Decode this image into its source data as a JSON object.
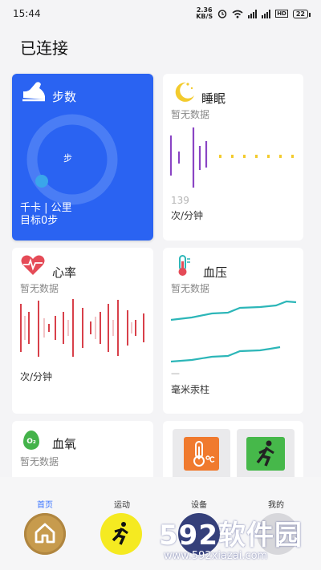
{
  "status_bar": {
    "time": "15:44",
    "net_speed_value": "2.36",
    "net_speed_unit": "KB/S",
    "hd_label": "HD",
    "battery": "22"
  },
  "page": {
    "title": "已连接"
  },
  "cards": {
    "steps": {
      "title": "步数",
      "ring_center": "步",
      "stats": "千卡 | 公里",
      "goal": "目标0步",
      "progress": 0
    },
    "sleep": {
      "title": "睡眠",
      "status": "暂无数据",
      "value": "139",
      "unit": "次/分钟"
    },
    "heart": {
      "title": "心率",
      "status": "暂无数据",
      "unit": "次/分钟"
    },
    "bp": {
      "title": "血压",
      "status": "暂无数据",
      "value": "—",
      "unit": "毫米汞柱"
    },
    "oxygen": {
      "title": "血氧",
      "status": "暂无数据",
      "icon_text": "O₂"
    }
  },
  "tabs": [
    {
      "label": "首页",
      "active": true
    },
    {
      "label": "运动",
      "active": false
    },
    {
      "label": "设备",
      "active": false
    },
    {
      "label": "我的",
      "active": false
    }
  ],
  "watermark": {
    "main": "592软件园",
    "url": "www.592xiazai.com"
  },
  "colors": {
    "accent": "#2a63f2",
    "tab_active": "#3a74ff",
    "sleep_bar": "#8a45c4",
    "heart_bar": "#d8404a",
    "bp_line": "#2cb6b8"
  }
}
